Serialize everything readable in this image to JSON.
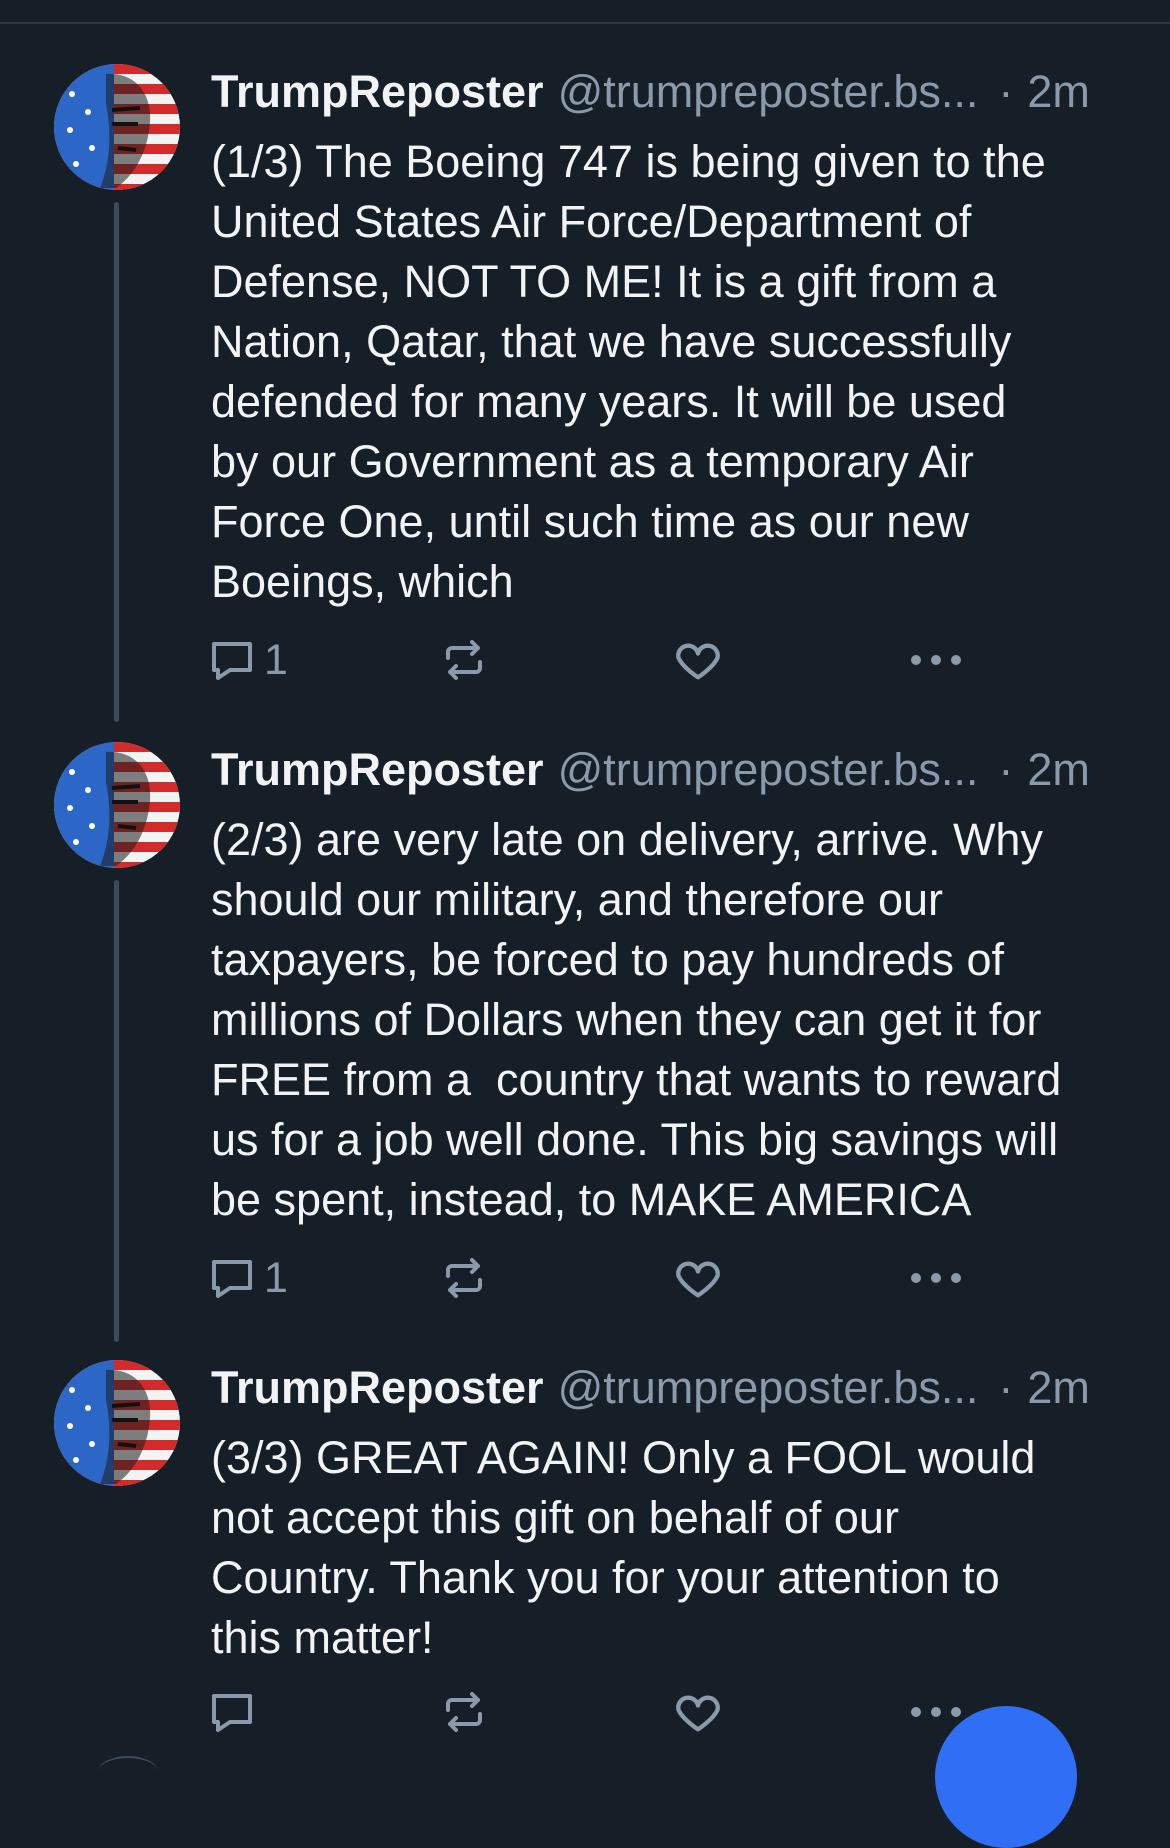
{
  "posts": [
    {
      "display_name": "TrumpReposter",
      "handle": "@trumpreposter.bs...",
      "separator": "·",
      "time": "2m",
      "text": "(1/3) The Boeing 747 is being given to the\nUnited States Air Force/Department of\nDefense, NOT TO ME! It is a gift from a\nNation, Qatar, that we have successfully\ndefended for many years. It will be used\nby our Government as a temporary Air\nForce One, until such time as our new\nBoeings, which",
      "reply_count": "1",
      "repost_count": "",
      "like_count": ""
    },
    {
      "display_name": "TrumpReposter",
      "handle": "@trumpreposter.bs...",
      "separator": "·",
      "time": "2m",
      "text": "(2/3) are very late on delivery, arrive. Why\nshould our military, and therefore our\ntaxpayers, be forced to pay hundreds of\nmillions of Dollars when they can get it for\nFREE from a  country that wants to reward\nus for a job well done. This big savings will\nbe spent, instead, to MAKE AMERICA",
      "reply_count": "1",
      "repost_count": "",
      "like_count": ""
    },
    {
      "display_name": "TrumpReposter",
      "handle": "@trumpreposter.bs...",
      "separator": "·",
      "time": "2m",
      "text": "(3/3) GREAT AGAIN! Only a FOOL would\nnot accept this gift on behalf of our\nCountry. Thank you for your attention to\nthis matter!",
      "reply_count": "",
      "repost_count": "",
      "like_count": ""
    }
  ],
  "icons": {
    "reply": "reply-icon",
    "repost": "repost-icon",
    "like": "heart-icon",
    "more": "more-icon",
    "compose": "compose-fab"
  },
  "colors": {
    "background": "#161e27",
    "text": "#f1f3f5",
    "muted": "#8a9aab",
    "thread_line": "#3c4b5b",
    "accent": "#2f6ef5"
  }
}
